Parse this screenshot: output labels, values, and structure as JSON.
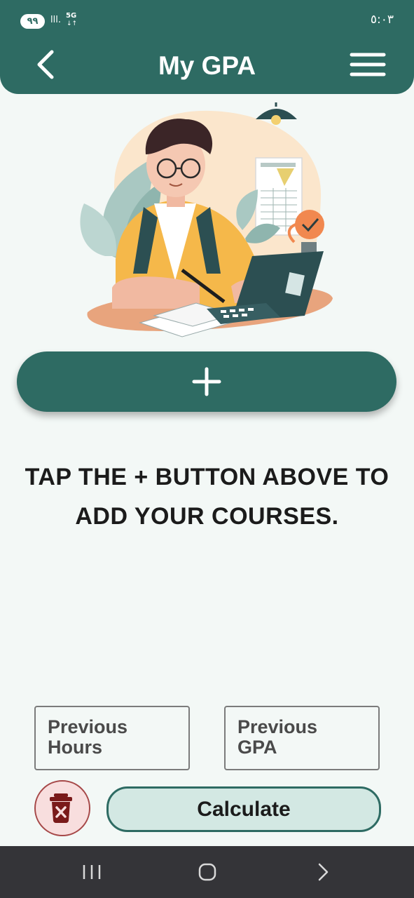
{
  "status_bar": {
    "battery": "٩٩",
    "signal": "lll.",
    "network": "5G",
    "network_arrows": "↓↑",
    "time": "٥:٠٣"
  },
  "header": {
    "title": "My GPA",
    "back_icon": "chevron-left-icon",
    "menu_icon": "hamburger-menu-icon"
  },
  "add_button": {
    "icon": "plus-icon"
  },
  "empty_state": {
    "line1": "TAP THE + BUTTON ABOVE TO",
    "line2": "ADD YOUR COURSES."
  },
  "inputs": {
    "previous_hours": {
      "placeholder_line1": "Previous",
      "placeholder_line2": "Hours",
      "value": ""
    },
    "previous_gpa": {
      "placeholder_line1": "Previous",
      "placeholder_line2": "GPA",
      "value": ""
    }
  },
  "actions": {
    "delete_icon": "trash-icon",
    "calculate_label": "Calculate"
  },
  "system_nav": {
    "recent_icon": "recent-apps-icon",
    "home_icon": "home-icon",
    "back_icon": "back-chevron-icon"
  },
  "colors": {
    "primary": "#2e6b63",
    "background": "#f3f8f6",
    "calculate_fill": "#d3e8e3",
    "delete_fill": "#f8dede",
    "delete_icon": "#7a1a1a",
    "nav_bar": "#343438"
  }
}
